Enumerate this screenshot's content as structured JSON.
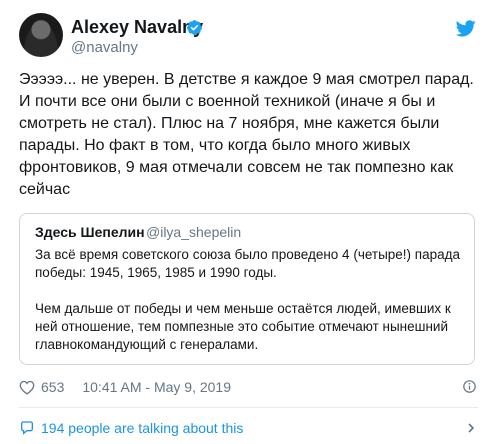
{
  "author": {
    "name": "Alexey Navalny",
    "handle": "@navalny"
  },
  "tweet": {
    "text": "Эээээ... не уверен. В детстве я каждое 9 мая смотрел парад.\nИ почти все они были с военной техникой (иначе я бы и\nсмотреть не стал). Плюс на 7 ноября, мне кажется были\nпарады. Но факт в том, что когда было много живых\nфронтовиков, 9 мая отмечали совсем не так помпезно как\nсейчас"
  },
  "quoted": {
    "name": "Здесь Шепелин",
    "handle": "@ilya_shepelin",
    "paragraph1": "За всё время советского союза было проведено 4 (четыре!) парада победы: 1945, 1965, 1985 и 1990 годы.",
    "paragraph2": "Чем дальше от победы и чем меньше остаётся людей, имевших к ней отношение, тем помпезные это событие отмечают нынешний главнокомандующий с генералами."
  },
  "meta": {
    "likes": "653",
    "timestamp": "10:41 AM - May 9, 2019"
  },
  "footer": {
    "talking": "194 people are talking about this"
  },
  "icons": {
    "verified": "verified-badge-icon",
    "bird": "twitter-bird-icon",
    "heart": "heart-icon",
    "info": "info-icon",
    "chat": "chat-bubble-icon",
    "chevron": "chevron-right-icon"
  },
  "colors": {
    "brand": "#1da1f2",
    "link": "#1b95e0",
    "secondary_text": "#657786",
    "border": "#ccd6dd"
  }
}
